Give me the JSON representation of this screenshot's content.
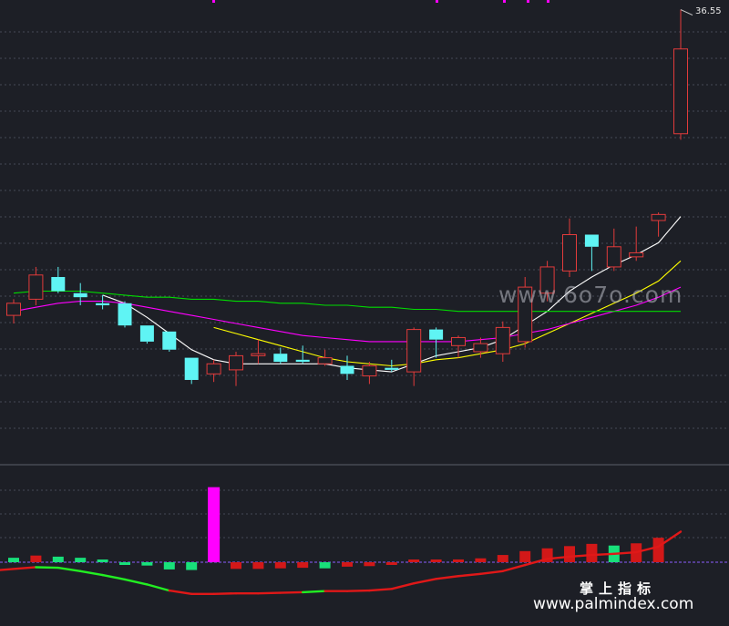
{
  "chart_data": {
    "type": "candlestick",
    "price_label": "36.55",
    "max_price": 36.55,
    "candles": [
      {
        "o": 21.4,
        "h": 22.2,
        "l": 21.0,
        "c": 22.0,
        "dir": "up"
      },
      {
        "o": 22.2,
        "h": 23.8,
        "l": 21.9,
        "c": 23.4,
        "dir": "up"
      },
      {
        "o": 23.3,
        "h": 23.8,
        "l": 22.5,
        "c": 22.6,
        "dir": "down"
      },
      {
        "o": 22.5,
        "h": 23.0,
        "l": 21.9,
        "c": 22.3,
        "dir": "down"
      },
      {
        "o": 22.0,
        "h": 22.4,
        "l": 21.7,
        "c": 21.9,
        "dir": "down"
      },
      {
        "o": 22.0,
        "h": 22.1,
        "l": 20.8,
        "c": 20.9,
        "dir": "down"
      },
      {
        "o": 20.9,
        "h": 20.9,
        "l": 20.0,
        "c": 20.1,
        "dir": "down"
      },
      {
        "o": 20.6,
        "h": 20.6,
        "l": 19.6,
        "c": 19.7,
        "dir": "down"
      },
      {
        "o": 19.3,
        "h": 19.3,
        "l": 18.0,
        "c": 18.2,
        "dir": "down"
      },
      {
        "o": 18.5,
        "h": 19.2,
        "l": 18.1,
        "c": 19.0,
        "dir": "up"
      },
      {
        "o": 18.7,
        "h": 19.6,
        "l": 17.9,
        "c": 19.4,
        "dir": "up"
      },
      {
        "o": 19.4,
        "h": 20.2,
        "l": 19.0,
        "c": 19.5,
        "dir": "up"
      },
      {
        "o": 19.5,
        "h": 19.8,
        "l": 19.0,
        "c": 19.1,
        "dir": "down"
      },
      {
        "o": 19.2,
        "h": 19.9,
        "l": 19.0,
        "c": 19.1,
        "dir": "down"
      },
      {
        "o": 19.0,
        "h": 19.7,
        "l": 18.9,
        "c": 19.3,
        "dir": "up"
      },
      {
        "o": 18.9,
        "h": 19.4,
        "l": 18.2,
        "c": 18.5,
        "dir": "down"
      },
      {
        "o": 18.4,
        "h": 19.1,
        "l": 18.0,
        "c": 18.9,
        "dir": "up"
      },
      {
        "o": 18.8,
        "h": 19.2,
        "l": 18.6,
        "c": 18.7,
        "dir": "down"
      },
      {
        "o": 18.6,
        "h": 20.8,
        "l": 17.9,
        "c": 20.7,
        "dir": "up"
      },
      {
        "o": 20.7,
        "h": 20.8,
        "l": 19.3,
        "c": 20.2,
        "dir": "down"
      },
      {
        "o": 19.9,
        "h": 20.4,
        "l": 19.3,
        "c": 20.3,
        "dir": "up"
      },
      {
        "o": 19.6,
        "h": 20.3,
        "l": 19.3,
        "c": 20.0,
        "dir": "up"
      },
      {
        "o": 19.5,
        "h": 21.1,
        "l": 19.1,
        "c": 20.8,
        "dir": "up"
      },
      {
        "o": 20.1,
        "h": 23.3,
        "l": 19.8,
        "c": 22.8,
        "dir": "up"
      },
      {
        "o": 22.5,
        "h": 24.1,
        "l": 22.1,
        "c": 23.8,
        "dir": "up"
      },
      {
        "o": 23.6,
        "h": 26.2,
        "l": 23.3,
        "c": 25.4,
        "dir": "up"
      },
      {
        "o": 25.4,
        "h": 25.4,
        "l": 23.6,
        "c": 24.8,
        "dir": "down"
      },
      {
        "o": 23.8,
        "h": 25.7,
        "l": 23.6,
        "c": 24.8,
        "dir": "up"
      },
      {
        "o": 24.3,
        "h": 25.8,
        "l": 24.1,
        "c": 24.5,
        "dir": "up"
      },
      {
        "o": 26.1,
        "h": 26.5,
        "l": 25.3,
        "c": 26.4,
        "dir": "up"
      },
      {
        "o": 30.4,
        "h": 36.55,
        "l": 30.1,
        "c": 34.6,
        "dir": "up"
      }
    ],
    "ma_series": [
      {
        "color": "#ffffff",
        "values": [
          null,
          null,
          null,
          null,
          22.4,
          22.0,
          21.3,
          20.5,
          19.7,
          19.2,
          19.0,
          19.0,
          19.0,
          19.0,
          19.0,
          18.8,
          18.7,
          18.6,
          19.0,
          19.4,
          19.6,
          19.8,
          20.2,
          20.9,
          21.6,
          22.6,
          23.3,
          23.9,
          24.4,
          25.0,
          26.3
        ]
      },
      {
        "color": "#ffff00",
        "values": [
          null,
          null,
          null,
          null,
          null,
          null,
          null,
          null,
          null,
          20.8,
          20.5,
          20.2,
          19.9,
          19.6,
          19.3,
          19.1,
          19.0,
          18.9,
          19.0,
          19.2,
          19.3,
          19.5,
          19.7,
          20.0,
          20.5,
          21.0,
          21.5,
          22.0,
          22.5,
          23.1,
          24.1
        ]
      },
      {
        "color": "#ff00ff",
        "values": [
          21.6,
          21.8,
          22.0,
          22.1,
          22.1,
          22.0,
          21.8,
          21.6,
          21.4,
          21.2,
          21.0,
          20.8,
          20.6,
          20.4,
          20.3,
          20.2,
          20.1,
          20.1,
          20.1,
          20.1,
          20.1,
          20.2,
          20.3,
          20.5,
          20.7,
          21.0,
          21.3,
          21.6,
          21.9,
          22.3,
          22.8
        ]
      },
      {
        "color": "#00dd00",
        "values": [
          22.5,
          22.6,
          22.6,
          22.6,
          22.5,
          22.4,
          22.3,
          22.3,
          22.2,
          22.2,
          22.1,
          22.1,
          22.0,
          22.0,
          21.9,
          21.9,
          21.8,
          21.8,
          21.7,
          21.7,
          21.6,
          21.6,
          21.6,
          21.6,
          21.6,
          21.6,
          21.6,
          21.6,
          21.6,
          21.6,
          21.6
        ]
      }
    ],
    "macd_bars": [
      {
        "v": 0.8,
        "c": "g"
      },
      {
        "v": 1.2,
        "c": "r"
      },
      {
        "v": 1.0,
        "c": "g"
      },
      {
        "v": 0.8,
        "c": "g"
      },
      {
        "v": 0.2,
        "c": "g"
      },
      {
        "v": -0.3,
        "c": "g"
      },
      {
        "v": -0.6,
        "c": "g"
      },
      {
        "v": -1.3,
        "c": "g"
      },
      {
        "v": -1.4,
        "c": "g"
      },
      {
        "v": 13.5,
        "c": "m"
      },
      {
        "v": -1.2,
        "c": "r"
      },
      {
        "v": -1.2,
        "c": "r"
      },
      {
        "v": -1.1,
        "c": "r"
      },
      {
        "v": -1.0,
        "c": "r"
      },
      {
        "v": -1.1,
        "c": "g"
      },
      {
        "v": -0.8,
        "c": "r"
      },
      {
        "v": -0.7,
        "c": "r"
      },
      {
        "v": -0.3,
        "c": "r"
      },
      {
        "v": 0.1,
        "c": "r"
      },
      {
        "v": 0.3,
        "c": "r"
      },
      {
        "v": 0.5,
        "c": "r"
      },
      {
        "v": 0.7,
        "c": "r"
      },
      {
        "v": 1.3,
        "c": "r"
      },
      {
        "v": 2.0,
        "c": "r"
      },
      {
        "v": 2.5,
        "c": "r"
      },
      {
        "v": 2.9,
        "c": "r"
      },
      {
        "v": 3.3,
        "c": "r"
      },
      {
        "v": 3.0,
        "c": "g"
      },
      {
        "v": 3.4,
        "c": "r"
      },
      {
        "v": 4.4,
        "c": "r"
      },
      {
        "v": 0,
        "c": "r"
      }
    ],
    "signal_line": [
      {
        "v": -1.4,
        "c": "r"
      },
      {
        "v": -0.9,
        "c": "r"
      },
      {
        "v": -1.0,
        "c": "g"
      },
      {
        "v": -1.6,
        "c": "g"
      },
      {
        "v": -2.3,
        "c": "g"
      },
      {
        "v": -3.1,
        "c": "g"
      },
      {
        "v": -4.0,
        "c": "g"
      },
      {
        "v": -5.1,
        "c": "g"
      },
      {
        "v": -5.7,
        "c": "r"
      },
      {
        "v": -5.7,
        "c": "r"
      },
      {
        "v": -5.6,
        "c": "r"
      },
      {
        "v": -5.6,
        "c": "r"
      },
      {
        "v": -5.5,
        "c": "r"
      },
      {
        "v": -5.4,
        "c": "r"
      },
      {
        "v": -5.2,
        "c": "g"
      },
      {
        "v": -5.2,
        "c": "r"
      },
      {
        "v": -5.1,
        "c": "r"
      },
      {
        "v": -4.8,
        "c": "r"
      },
      {
        "v": -3.8,
        "c": "r"
      },
      {
        "v": -3.0,
        "c": "r"
      },
      {
        "v": -2.5,
        "c": "r"
      },
      {
        "v": -2.1,
        "c": "r"
      },
      {
        "v": -1.6,
        "c": "r"
      },
      {
        "v": -0.5,
        "c": "r"
      },
      {
        "v": 0.6,
        "c": "r"
      },
      {
        "v": 1.0,
        "c": "r"
      },
      {
        "v": 1.3,
        "c": "r"
      },
      {
        "v": 1.5,
        "c": "r"
      },
      {
        "v": 1.8,
        "c": "r"
      },
      {
        "v": 2.8,
        "c": "r"
      },
      {
        "v": 5.5,
        "c": "r"
      }
    ],
    "colors": {
      "background": "#1d1f26",
      "up": "#e23b3b",
      "down": "#5ff4f4",
      "grid": "#454a57",
      "bar_up": "#d21818",
      "bar_down": "#18e07a",
      "spike": "#ff00ff"
    },
    "grid": true
  },
  "watermark": {
    "main": "www.6o7o.com",
    "cn": "掌上指标",
    "url": "www.palmindex.com"
  }
}
